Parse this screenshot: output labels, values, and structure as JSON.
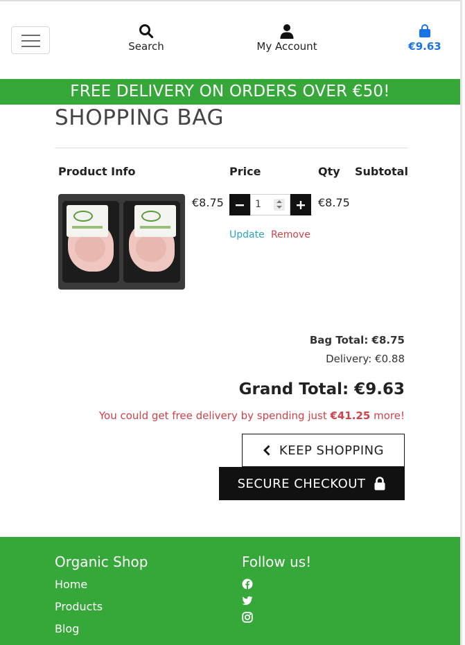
{
  "header": {
    "menu_icon": "hamburger-icon",
    "search_label": "Search",
    "account_label": "My Account",
    "bag_total": "€9.63"
  },
  "banner": {
    "text": "FREE DELIVERY ON ORDERS OVER €50!"
  },
  "page": {
    "title": "SHOPPING BAG"
  },
  "table": {
    "headers": [
      "Product Info",
      "Price",
      "Qty",
      "Subtotal"
    ],
    "items": [
      {
        "price": "€8.75",
        "quantity": "1",
        "subtotal": "€8.75",
        "update_label": "Update",
        "remove_label": "Remove"
      }
    ]
  },
  "totals": {
    "bag_total": "Bag Total: €8.75",
    "delivery": "Delivery: €0.88",
    "grand_total": "Grand Total: €9.63",
    "free_delivery_prefix": "You could get free delivery by spending just ",
    "free_delivery_amount": "€41.25",
    "free_delivery_suffix": " more!"
  },
  "actions": {
    "keep_shopping": "KEEP SHOPPING",
    "secure_checkout": "SECURE CHECKOUT"
  },
  "footer": {
    "shop_title": "Organic Shop",
    "links": [
      "Home",
      "Products",
      "Blog"
    ],
    "follow_title": "Follow us!",
    "social_icons": [
      "facebook-icon",
      "twitter-icon",
      "instagram-icon"
    ]
  },
  "colors": {
    "brand_green": "#36a83a",
    "accent_blue": "#1a73e8",
    "danger_red": "#d0414a",
    "link_teal": "#2aa5bf"
  }
}
